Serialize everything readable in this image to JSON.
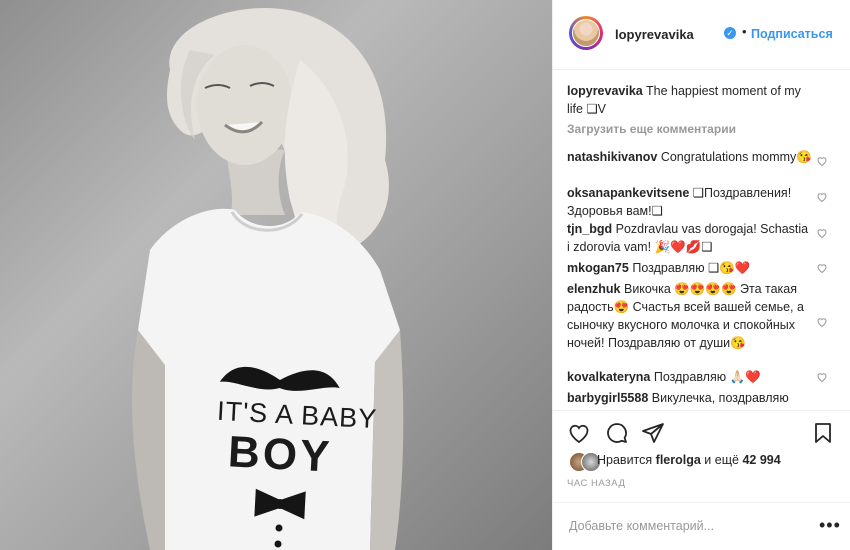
{
  "post": {
    "username": "lopyrevavika",
    "follow_label": "Подписаться",
    "separator": "•",
    "verified_icon": "verified-badge-icon"
  },
  "photo": {
    "tshirt_line1": "IT'S A BABY",
    "tshirt_line2": "BOY"
  },
  "caption": {
    "username": "lopyrevavika",
    "text": "The happiest moment of my life ❑V"
  },
  "load_more_label": "Загрузить еще комментарии",
  "comments": [
    {
      "username": "natashikivanov",
      "text": "Congratulations mommy😘"
    },
    {
      "username": "oksanapankevitsene",
      "text": "❑Поздравления! Здоровья вам!❑"
    },
    {
      "username": "tjn_bgd",
      "text": "Pozdravlau vas dorogaja! Schastia i zdorovia vam! 🎉❤️💋❑"
    },
    {
      "username": "mkogan75",
      "text": "Поздравляю ❑😘❤️"
    },
    {
      "username": "elenzhuk",
      "text": "Викочка 😍😍😍😍 Эта такая радость😍 Счастья всей вашей семье, а сыночку вкусного молочка и спокойных ночей! Поздравляю от души😘"
    },
    {
      "username": "kovalkateryna",
      "text": "Поздравляю 🙏🏻❤️"
    },
    {
      "username": "barbygirl5588",
      "text": "Викулечка, поздравляю"
    }
  ],
  "likes": {
    "prefix": "Нравится",
    "user": "flerolga",
    "middle": "и ещё",
    "count": "42 994"
  },
  "timestamp": "ЧАС НАЗАД",
  "add_comment_placeholder": "Добавьте комментарий...",
  "more_label": "•••",
  "colors": {
    "accent": "#3897f0",
    "muted": "#999999",
    "border": "#efefef",
    "like_red": "#ed4956"
  }
}
